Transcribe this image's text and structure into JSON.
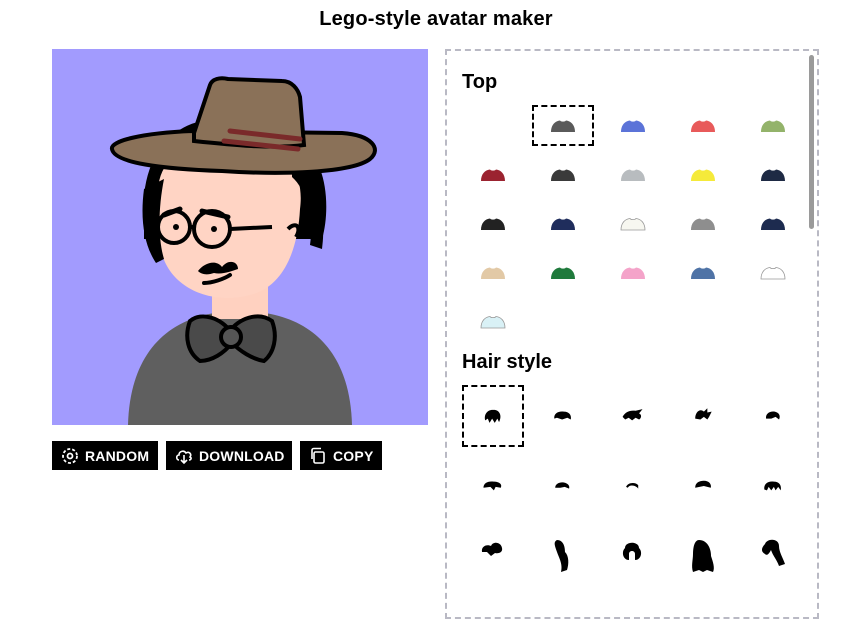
{
  "app": {
    "title": "Lego-style avatar maker"
  },
  "preview": {
    "background": "#a29bfe"
  },
  "actions": {
    "random_label": "RANDOM",
    "download_label": "DOWNLOAD",
    "copy_label": "COPY"
  },
  "sections": {
    "top": {
      "title": "Top",
      "options": [
        {
          "id": "none",
          "color": ""
        },
        {
          "id": "gray",
          "color": "#5a5a5a",
          "selected": true
        },
        {
          "id": "blue",
          "color": "#5b73d8"
        },
        {
          "id": "red",
          "color": "#e85a5a"
        },
        {
          "id": "green",
          "color": "#93b36a"
        },
        {
          "id": "maroon",
          "color": "#9b2330"
        },
        {
          "id": "dark-badge",
          "color": "#3a3a3a"
        },
        {
          "id": "light-gray",
          "color": "#b8bcbf"
        },
        {
          "id": "yellow",
          "color": "#f5ea3a"
        },
        {
          "id": "navy-tie",
          "color": "#1e2a44"
        },
        {
          "id": "black-suit",
          "color": "#222222"
        },
        {
          "id": "navy-floral",
          "color": "#1f2d5c"
        },
        {
          "id": "white-dots",
          "color": "#f7f7f0"
        },
        {
          "id": "gray-suit",
          "color": "#8e8e8e"
        },
        {
          "id": "dark-navy",
          "color": "#1d2b4f"
        },
        {
          "id": "beige",
          "color": "#e2c9a6"
        },
        {
          "id": "green-collar",
          "color": "#1f7a3c"
        },
        {
          "id": "pink",
          "color": "#f4a3c9"
        },
        {
          "id": "denim",
          "color": "#4f73a6"
        },
        {
          "id": "white-shirt",
          "color": "#ffffff"
        },
        {
          "id": "light-blue-shirt",
          "color": "#d9f1f6"
        }
      ]
    },
    "hair": {
      "title": "Hair style",
      "options": [
        {
          "id": "hair-1",
          "selected": true
        },
        {
          "id": "hair-2"
        },
        {
          "id": "hair-3"
        },
        {
          "id": "hair-4"
        },
        {
          "id": "hair-5"
        },
        {
          "id": "hair-6"
        },
        {
          "id": "hair-7"
        },
        {
          "id": "hair-8"
        },
        {
          "id": "hair-9"
        },
        {
          "id": "hair-10"
        },
        {
          "id": "hair-11"
        },
        {
          "id": "hair-12"
        },
        {
          "id": "hair-13"
        },
        {
          "id": "hair-14"
        },
        {
          "id": "hair-15"
        }
      ]
    }
  }
}
